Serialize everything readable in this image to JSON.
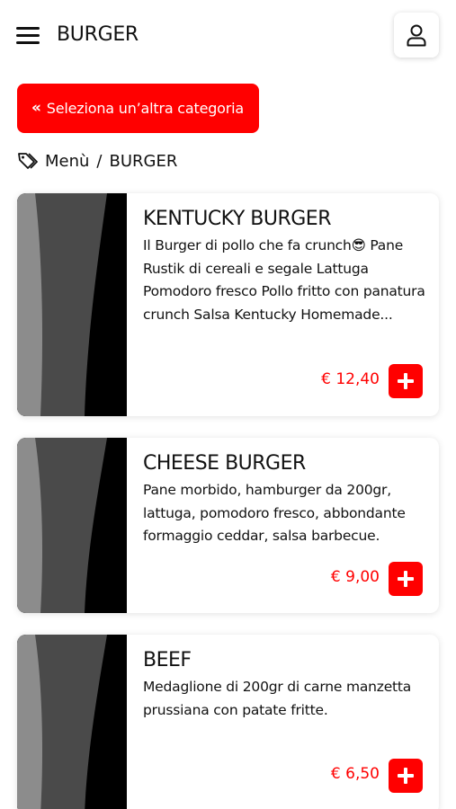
{
  "header": {
    "title": "BURGER",
    "menu_icon": "hamburger-menu-icon",
    "user_icon": "user-icon"
  },
  "back_button": {
    "label": "Seleziona un’altra categoria",
    "icon": "double-chevron-left-icon"
  },
  "breadcrumb": {
    "icon": "tag-icon",
    "root": "Menù",
    "separator": "/",
    "current": "BURGER"
  },
  "products": [
    {
      "name": "KENTUCKY BURGER",
      "description": "Il Burger di pollo che fa crunch😎  Pane Rustik di cereali e segale Lattuga Pomodoro fresco Pollo fritto con panatura crunch Salsa Kentucky Homemade...",
      "price": "€ 12,40"
    },
    {
      "name": "CHEESE BURGER",
      "description": "Pane morbido, hamburger da 200gr, lattuga, pomodoro fresco, abbondante formaggio ceddar, salsa barbecue.",
      "price": "€ 9,00"
    },
    {
      "name": "BEEF",
      "description": "Medaglione di 200gr di carne manzetta prussiana con patate fritte.",
      "price": "€ 6,50"
    }
  ],
  "colors": {
    "accent": "#ff0000",
    "text": "#111111",
    "background": "#ffffff"
  }
}
